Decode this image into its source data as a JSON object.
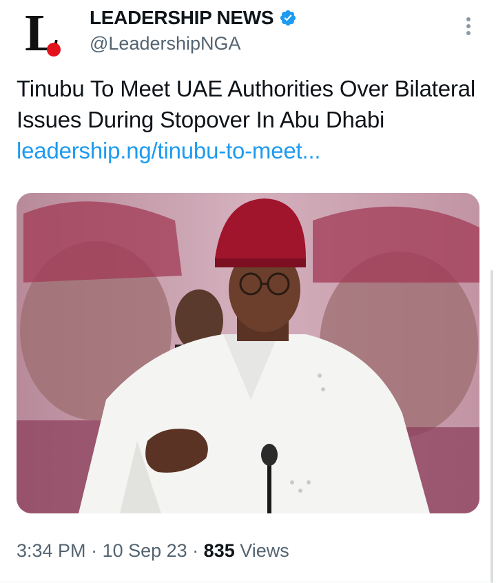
{
  "account": {
    "display_name": "LEADERSHIP NEWS",
    "handle": "@LeadershipNGA",
    "verified": true,
    "avatar_icon": "leadership-logo-icon",
    "brand_red": "#e3111b"
  },
  "tweet": {
    "text": "Tinubu To Meet UAE Authorities Over Bilateral Issues During Stopover In Abu Dhabi ",
    "link_text": "leadership.ng/tinubu-to-meet...",
    "link_color": "#1d9bf0"
  },
  "media": {
    "type": "photo",
    "subject": "man in red cap and white agbada speaking at a microphone"
  },
  "meta": {
    "time": "3:34 PM",
    "separator": " · ",
    "date": "10 Sep 23",
    "views_count": "835",
    "views_label": " Views"
  },
  "icons": {
    "verified": "verified-badge-icon",
    "more": "more-options-icon"
  }
}
